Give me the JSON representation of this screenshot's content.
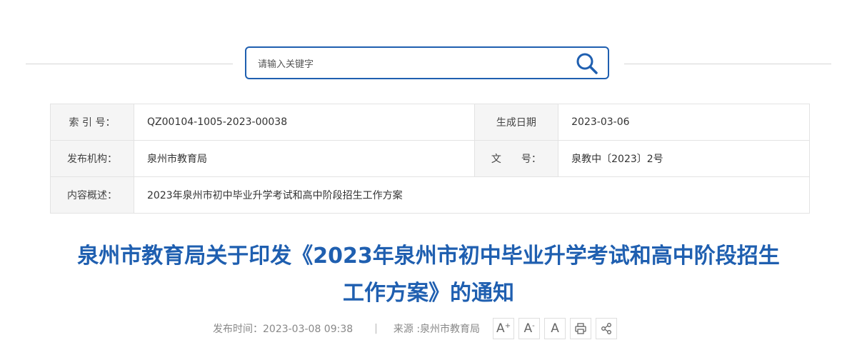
{
  "search": {
    "placeholder": "请输入关键字"
  },
  "meta": {
    "index_label": "索 引 号：",
    "index_value": "QZ00104-1005-2023-00038",
    "date_label": "生成日期",
    "date_value": "2023-03-06",
    "org_label": "发布机构：",
    "org_value": "泉州市教育局",
    "doc_label": "文　　号：",
    "doc_value": "泉教中〔2023〕2号",
    "summary_label": "内容概述：",
    "summary_value": "2023年泉州市初中毕业升学考试和高中阶段招生工作方案"
  },
  "article": {
    "title_line1": "泉州市教育局关于印发《2023年泉州市初中毕业升学考试和高中阶段招生",
    "title_line2": "工作方案》的通知",
    "publish_time": "发布时间：2023-03-08 09:38",
    "divider": "|",
    "source": "来源 :泉州市教育局"
  },
  "tools": {
    "font_large": "A",
    "font_large_sup": "+",
    "font_small": "A",
    "font_small_sup": "-",
    "font_reset": "A"
  },
  "colors": {
    "accent": "#1f5fb0",
    "label_bg": "#f5f5f5",
    "border": "#e3e3e3"
  },
  "icons": [
    "search-icon",
    "print-icon",
    "share-icon"
  ]
}
